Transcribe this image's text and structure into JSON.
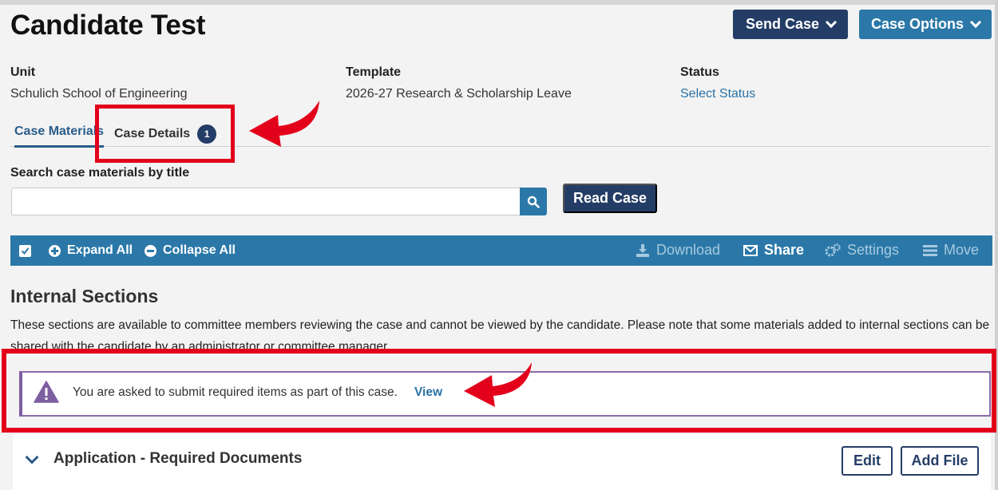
{
  "header": {
    "title": "Candidate Test",
    "send_case_label": "Send Case",
    "case_options_label": "Case Options"
  },
  "meta": {
    "unit_label": "Unit",
    "unit_value": "Schulich School of Engineering",
    "template_label": "Template",
    "template_value": "2026-27 Research & Scholarship Leave",
    "status_label": "Status",
    "status_value": "Select Status"
  },
  "tabs": [
    {
      "label": "Case Materials",
      "active": true
    },
    {
      "label": "Case Details",
      "badge": "1"
    }
  ],
  "search": {
    "label": "Search case materials by title",
    "placeholder": "",
    "read_case_label": "Read Case"
  },
  "toolbar": {
    "expand_all": "Expand All",
    "collapse_all": "Collapse All",
    "download": "Download",
    "share": "Share",
    "settings": "Settings",
    "move": "Move"
  },
  "section": {
    "title": "Internal Sections",
    "description": "These sections are available to committee members reviewing the case and cannot be viewed by the candidate. Please note that some materials added to internal sections can be shared with the candidate by an administrator or committee manager."
  },
  "alert": {
    "text": "You are asked to submit required items as part of this case.",
    "link": "View"
  },
  "panel": {
    "title": "Application - Required Documents",
    "edit_label": "Edit",
    "add_file_label": "Add File"
  },
  "colors": {
    "navy": "#243d66",
    "blue": "#2b78a8",
    "link": "#2a72a6",
    "highlight": "#e3001b",
    "alert_purple": "#7d5ea0"
  }
}
